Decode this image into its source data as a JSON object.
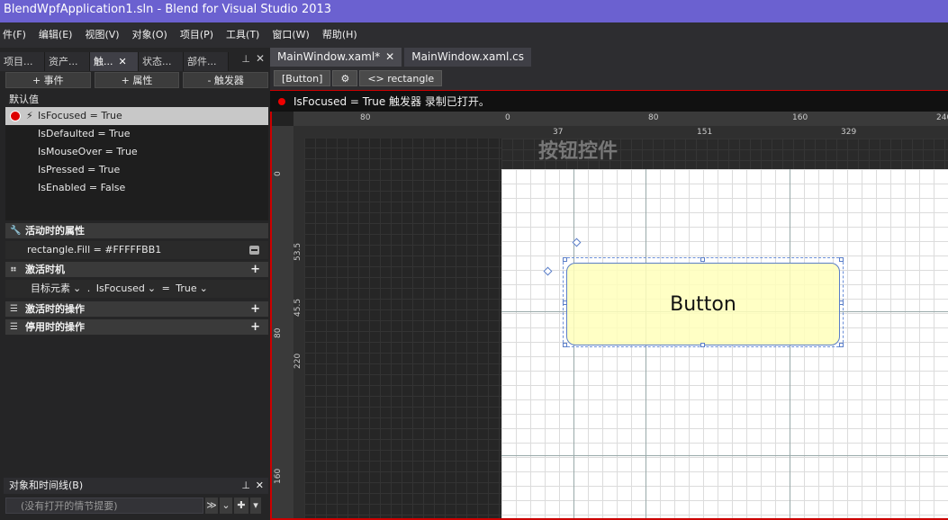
{
  "window": {
    "title": "BlendWpfApplication1.sln - Blend for Visual Studio 2013"
  },
  "menu": [
    "件(F)",
    "编辑(E)",
    "视图(V)",
    "对象(O)",
    "项目(P)",
    "工具(T)",
    "窗口(W)",
    "帮助(H)"
  ],
  "left_tabs": [
    {
      "label": "项目..."
    },
    {
      "label": "资产..."
    },
    {
      "label": "触...",
      "close": "✕"
    },
    {
      "label": "状态..."
    },
    {
      "label": "部件..."
    }
  ],
  "panel_pin": "⊥",
  "panel_close": "✕",
  "trigger_buttons": [
    "+ 事件",
    "+ 属性",
    "- 触发器"
  ],
  "default_label": "默认值",
  "triggers": [
    "IsFocused = True",
    "IsDefaulted = True",
    "IsMouseOver = True",
    "IsPressed = True",
    "IsEnabled = False"
  ],
  "sections": {
    "active_props": "活动时的属性",
    "activation": "激活时机",
    "enter_actions": "激活时的操作",
    "exit_actions": "停用时的操作"
  },
  "active_prop_row": "rectangle.Fill = #FFFFFBB1",
  "condition": {
    "target": "目标元素",
    "sep": ".",
    "property": "IsFocused",
    "eq": "=",
    "value": "True"
  },
  "objects_timeline": {
    "label": "对象和时间线(B)",
    "placeholder": "(没有打开的情节提要)"
  },
  "doc_tabs": [
    {
      "label": "MainWindow.xaml*",
      "close": "✕"
    },
    {
      "label": "MainWindow.xaml.cs"
    }
  ],
  "breadcrumb": [
    "[Button]",
    "",
    "<> rectangle"
  ],
  "record_bar": "IsFocused = True 触发器 录制已打开。",
  "rulers": {
    "h": [
      "80",
      "0",
      "80",
      "160",
      "240"
    ],
    "v": [
      "0",
      "80",
      "160"
    ],
    "row": [
      "37",
      "151",
      "329"
    ],
    "col": [
      "53.5",
      "45.5",
      "220"
    ]
  },
  "grid_title": "按钮控件",
  "button_text": "Button",
  "colors": {
    "title_bar": "#6b61d0",
    "record": "#e00000",
    "button_fill": "#FFFFBB"
  }
}
